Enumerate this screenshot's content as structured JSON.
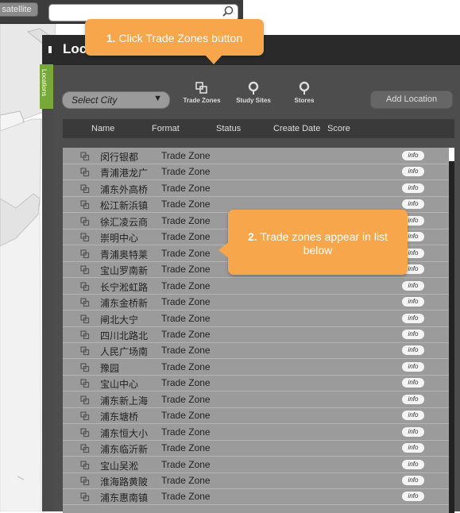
{
  "map": {
    "satellite_label": "satellite",
    "search_placeholder": "",
    "search_icon": "magnifier-icon"
  },
  "panel": {
    "title": "Locations",
    "side_tab_label": "Locations",
    "select_city": {
      "label": "Select City",
      "caret": "▼"
    },
    "tools": [
      {
        "label": "Trade Zones",
        "icon": "trade-zones-icon"
      },
      {
        "label": "Study Sites",
        "icon": "pin-icon"
      },
      {
        "label": "Stores",
        "icon": "pin-icon"
      }
    ],
    "add_location_label": "Add Location",
    "columns": {
      "name": "Name",
      "format": "Format",
      "status": "Status",
      "create_date": "Create Date",
      "score": "Score"
    },
    "info_label": "info",
    "rows": [
      {
        "name": "闵行银都",
        "format": "Trade Zone"
      },
      {
        "name": "青浦港龙广",
        "format": "Trade Zone"
      },
      {
        "name": "浦东外高桥",
        "format": "Trade Zone"
      },
      {
        "name": "松江新浜镇",
        "format": "Trade Zone"
      },
      {
        "name": "徐汇凌云商",
        "format": "Trade Zone"
      },
      {
        "name": "崇明中心",
        "format": "Trade Zone"
      },
      {
        "name": "青浦奥特莱",
        "format": "Trade Zone"
      },
      {
        "name": "宝山罗南新",
        "format": "Trade Zone"
      },
      {
        "name": "长宁淞虹路",
        "format": "Trade Zone"
      },
      {
        "name": "浦东金桥新",
        "format": "Trade Zone"
      },
      {
        "name": "闸北大宁",
        "format": "Trade Zone"
      },
      {
        "name": "四川北路北",
        "format": "Trade Zone"
      },
      {
        "name": "人民广场南",
        "format": "Trade Zone"
      },
      {
        "name": "豫园",
        "format": "Trade Zone"
      },
      {
        "name": "宝山中心",
        "format": "Trade Zone"
      },
      {
        "name": "浦东新上海",
        "format": "Trade Zone"
      },
      {
        "name": "浦东塘桥",
        "format": "Trade Zone"
      },
      {
        "name": "浦东恒大小",
        "format": "Trade Zone"
      },
      {
        "name": "浦东临沂新",
        "format": "Trade Zone"
      },
      {
        "name": "宝山吴淞",
        "format": "Trade Zone"
      },
      {
        "name": "淮海路黄陂",
        "format": "Trade Zone"
      },
      {
        "name": "浦东惠南镇",
        "format": "Trade Zone"
      }
    ]
  },
  "callouts": {
    "step1_number": "1.",
    "step1_text": "Click Trade Zones button",
    "step2_number": "2.",
    "step2_text": "Trade zones appear in list below"
  },
  "colors": {
    "callout": "#f7a64b",
    "side_tab": "#77a83a",
    "panel_header": "#2a2a2a",
    "list_bg": "#9b9b9b"
  }
}
